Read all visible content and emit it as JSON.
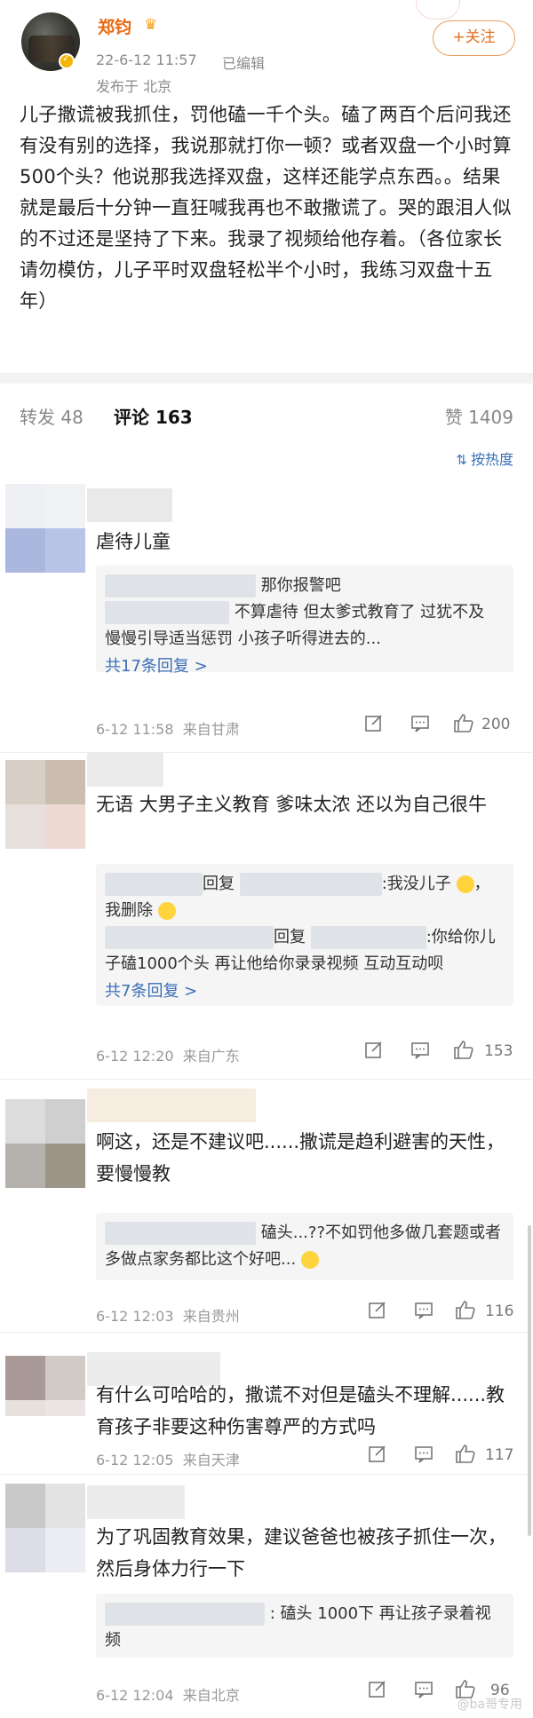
{
  "post": {
    "author": "郑钧",
    "crown_icon": "crown-icon",
    "datetime": "22-6-12 11:57",
    "edited": "已编辑",
    "location": "发布于 北京",
    "follow_label": "+关注",
    "body": "儿子撒谎被我抓住，罚他磕一千个头。磕了两百个后问我还有没有别的选择，我说那就打你一顿？或者双盘一个小时算500个头？他说那我选择双盘，这样还能学点东西。。结果就是最后十分钟一直狂喊我再也不敢撒谎了。哭的跟泪人似的不过还是坚持了下来。我录了视频给他存着。（各位家长请勿模仿，儿子平时双盘轻松半个小时，我练习双盘十五年）"
  },
  "tabs": {
    "repost": "转发 48",
    "comments": "评论 163",
    "likes": "赞 1409"
  },
  "sort": {
    "label": "按热度",
    "icon": "sort-icon"
  },
  "comments": [
    {
      "text": "虐待儿童",
      "replies": [
        {
          "text": "那你报警吧"
        },
        {
          "text": "不算虐待 但太爹式教育了 过犹不及 慢慢引导适当惩罚 小孩子听得进去的..."
        }
      ],
      "more": "共17条回复 >",
      "time": "6-12 11:58",
      "from": "来自甘肃",
      "likes": "200"
    },
    {
      "text": "无语 大男子主义教育 爹味太浓 还以为自己很牛",
      "replies": [
        {
          "prefix": "回复",
          "text": ":我没儿子",
          "tail": "，我删除"
        },
        {
          "prefix": "回复",
          "text": ":你给你儿子磕1000个头 再让他给你录录视频 互动互动呗"
        }
      ],
      "more": "共7条回复 >",
      "time": "6-12 12:20",
      "from": "来自广东",
      "likes": "153"
    },
    {
      "text": "啊这，还是不建议吧......撒谎是趋利避害的天性，要慢慢教",
      "replies": [
        {
          "text": "磕头...??不如罚他多做几套题或者多做点家务都比这个好吧..."
        }
      ],
      "time": "6-12 12:03",
      "from": "来自贵州",
      "likes": "116"
    },
    {
      "text": "有什么可哈哈的，撒谎不对但是磕头不理解......教育孩子非要这种伤害尊严的方式吗",
      "time": "6-12 12:05",
      "from": "来自天津",
      "likes": "117"
    },
    {
      "text": "为了巩固教育效果，建议爸爸也被孩子抓住一次，然后身体力行一下",
      "replies": [
        {
          "text": ": 磕头 1000下 再让孩子录着视频"
        }
      ],
      "time": "6-12 12:04",
      "from": "来自北京",
      "likes": "96"
    }
  ],
  "icons": {
    "share": "share-icon",
    "comment": "comment-icon",
    "like": "thumbs-up-icon"
  },
  "watermark": "@ba哥专用",
  "colors": {
    "author": "#e86a10",
    "accent": "#f08a20",
    "link": "#3b6fb6"
  }
}
